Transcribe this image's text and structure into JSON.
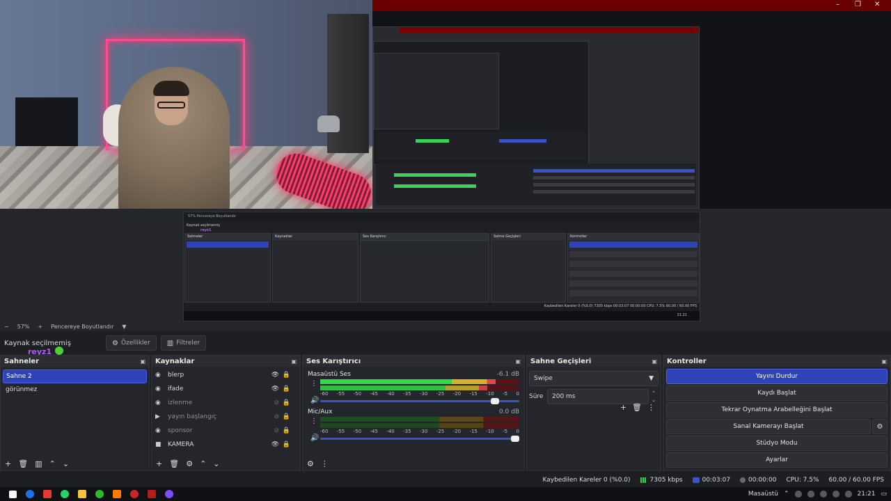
{
  "preview": {
    "mirror": {
      "zoom_strip": "57%   Pencereye Boyutlandır",
      "context_label": "Kaynak seçilmemiş",
      "reyz": "reyz1",
      "scenes_title": "Sahneler",
      "sources_title": "Kaynaklar",
      "mixer_title": "Ses Karıştırıcı",
      "transitions_title": "Sahne Geçişleri",
      "controls_title": "Kontroller",
      "status_text": "Kaybedilen Kareler 0 (%0.0)   7305 kbps   00:03:07   00:00:00   CPU: 7.5%   60.00 / 60.00 FPS",
      "clock": "21:21"
    }
  },
  "zoombar": {
    "minus": "−",
    "zoom": "57%",
    "plus": "+",
    "fit_label": "Pencereye Boyutlandır",
    "dropdown_icon": "▼"
  },
  "context": {
    "no_source": "Kaynak seçilmemiş",
    "properties_label": "Özellikler",
    "filters_label": "Filtreler",
    "overlay_name": "reyz1"
  },
  "scenes": {
    "title": "Sahneler",
    "items": [
      {
        "label": "Sahne 2",
        "active": true
      },
      {
        "label": "görünmez",
        "active": false
      }
    ],
    "footer_icons": [
      "plus-icon",
      "trash-icon",
      "filter-icon",
      "up-icon",
      "down-icon"
    ]
  },
  "sources": {
    "title": "Kaynaklar",
    "items": [
      {
        "label": "blerp",
        "icon": "browser-icon",
        "visible": true
      },
      {
        "label": "ifade",
        "icon": "browser-icon",
        "visible": true
      },
      {
        "label": "izlenme",
        "icon": "browser-icon",
        "visible": false
      },
      {
        "label": "yayın başlangıç",
        "icon": "media-icon",
        "visible": false
      },
      {
        "label": "sponsor",
        "icon": "browser-icon",
        "visible": false
      },
      {
        "label": "KAMERA",
        "icon": "camera-icon",
        "visible": true
      }
    ]
  },
  "mixer": {
    "title": "Ses Karıştırıcı",
    "channels": [
      {
        "name": "Masaüstü Ses",
        "db": "-6.1 dB",
        "level": 0.88,
        "volume": 0.9
      },
      {
        "name": "Mic/Aux",
        "db": "0.0 dB",
        "level": 0.0,
        "volume": 1.0
      }
    ],
    "ticks": [
      "-60",
      "-55",
      "-50",
      "-45",
      "-40",
      "-35",
      "-30",
      "-25",
      "-20",
      "-15",
      "-10",
      "-5",
      "0"
    ]
  },
  "transitions": {
    "title": "Sahne Geçişleri",
    "selected": "Swipe",
    "duration_label": "Süre",
    "duration_value": "200 ms"
  },
  "controls": {
    "title": "Kontroller",
    "stop_stream": "Yayını Durdur",
    "start_recording": "Kaydı Başlat",
    "start_replay": "Tekrar Oynatma Arabelleğini Başlat",
    "start_vcam": "Sanal Kamerayı Başlat",
    "studio_mode": "Stüdyo Modu",
    "settings": "Ayarlar"
  },
  "status": {
    "dropped": "Kaybedilen Kareler 0 (%0.0)",
    "bitrate": "7305 kbps",
    "live_time": "00:03:07",
    "rec_time": "00:00:00",
    "cpu": "CPU: 7.5%",
    "fps": "60.00 / 60.00 FPS"
  },
  "taskbar": {
    "desktop": "Masaüstü",
    "clock": "21:21",
    "colors": [
      "#1f6feb",
      "#e53935",
      "#25d366",
      "#f5c542",
      "#2eb82e",
      "#ff7a00",
      "#c62828",
      "#b71c1c",
      "#7c4dff"
    ]
  },
  "window": {
    "minimize": "–",
    "maximize": "❐",
    "close": "✕"
  }
}
